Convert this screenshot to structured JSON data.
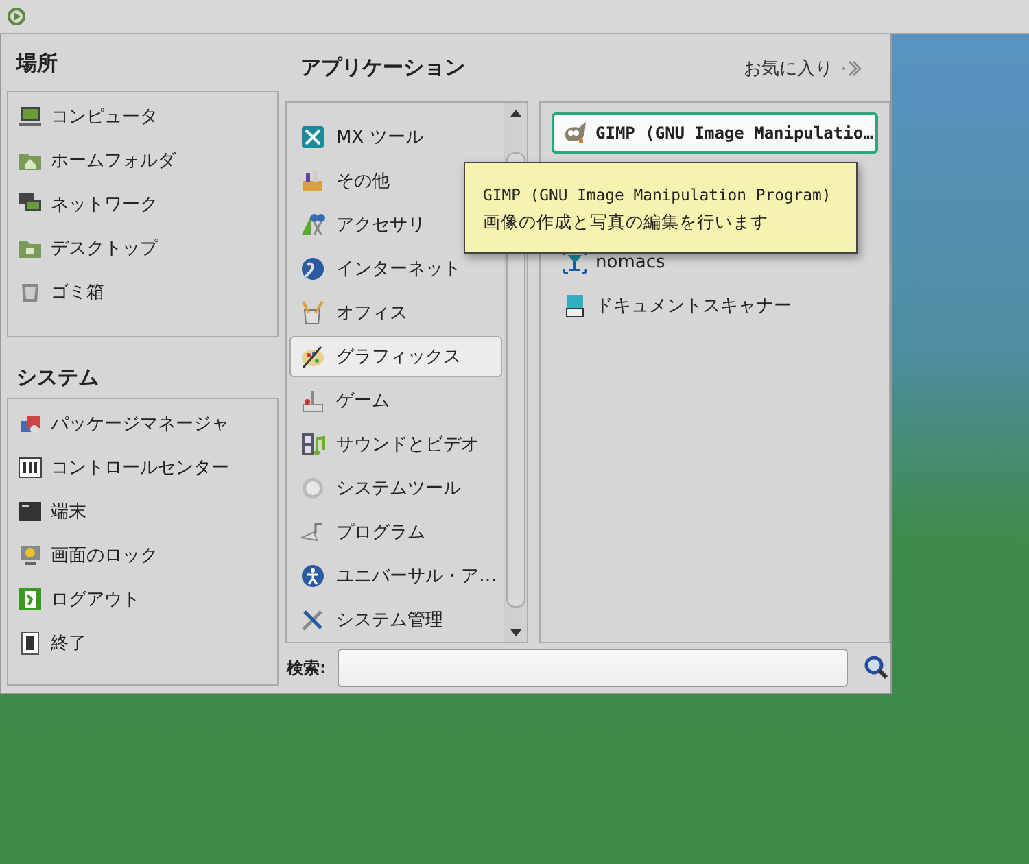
{
  "places": {
    "title": "場所",
    "items": [
      {
        "label": "コンピュータ"
      },
      {
        "label": "ホームフォルダ"
      },
      {
        "label": "ネットワーク"
      },
      {
        "label": "デスクトップ"
      },
      {
        "label": "ゴミ箱"
      }
    ]
  },
  "system": {
    "title": "システム",
    "items": [
      {
        "label": "パッケージマネージャ"
      },
      {
        "label": "コントロールセンター"
      },
      {
        "label": "端末"
      },
      {
        "label": "画面のロック"
      },
      {
        "label": "ログアウト"
      },
      {
        "label": "終了"
      }
    ]
  },
  "applications": {
    "title": "アプリケーション",
    "categories": [
      {
        "label": "MX ツール",
        "selected": false
      },
      {
        "label": "その他",
        "selected": false
      },
      {
        "label": "アクセサリ",
        "selected": false
      },
      {
        "label": "インターネット",
        "selected": false
      },
      {
        "label": "オフィス",
        "selected": false
      },
      {
        "label": "グラフィックス",
        "selected": true
      },
      {
        "label": "ゲーム",
        "selected": false
      },
      {
        "label": "サウンドとビデオ",
        "selected": false
      },
      {
        "label": "システムツール",
        "selected": false
      },
      {
        "label": "プログラム",
        "selected": false
      },
      {
        "label": "ユニバーサル・ア…",
        "selected": false
      },
      {
        "label": "システム管理",
        "selected": false
      }
    ]
  },
  "favorites": {
    "label": "お気に入り"
  },
  "app_list": [
    {
      "label": "GIMP (GNU Image Manipulatio…",
      "selected": true
    },
    {
      "label": "nomacs",
      "selected": false
    },
    {
      "label": "ドキュメントスキャナー",
      "selected": false
    }
  ],
  "tooltip": {
    "title": "GIMP (GNU Image Manipulation Program)",
    "description": "画像の作成と写真の編集を行います"
  },
  "search": {
    "label": "検索:"
  }
}
